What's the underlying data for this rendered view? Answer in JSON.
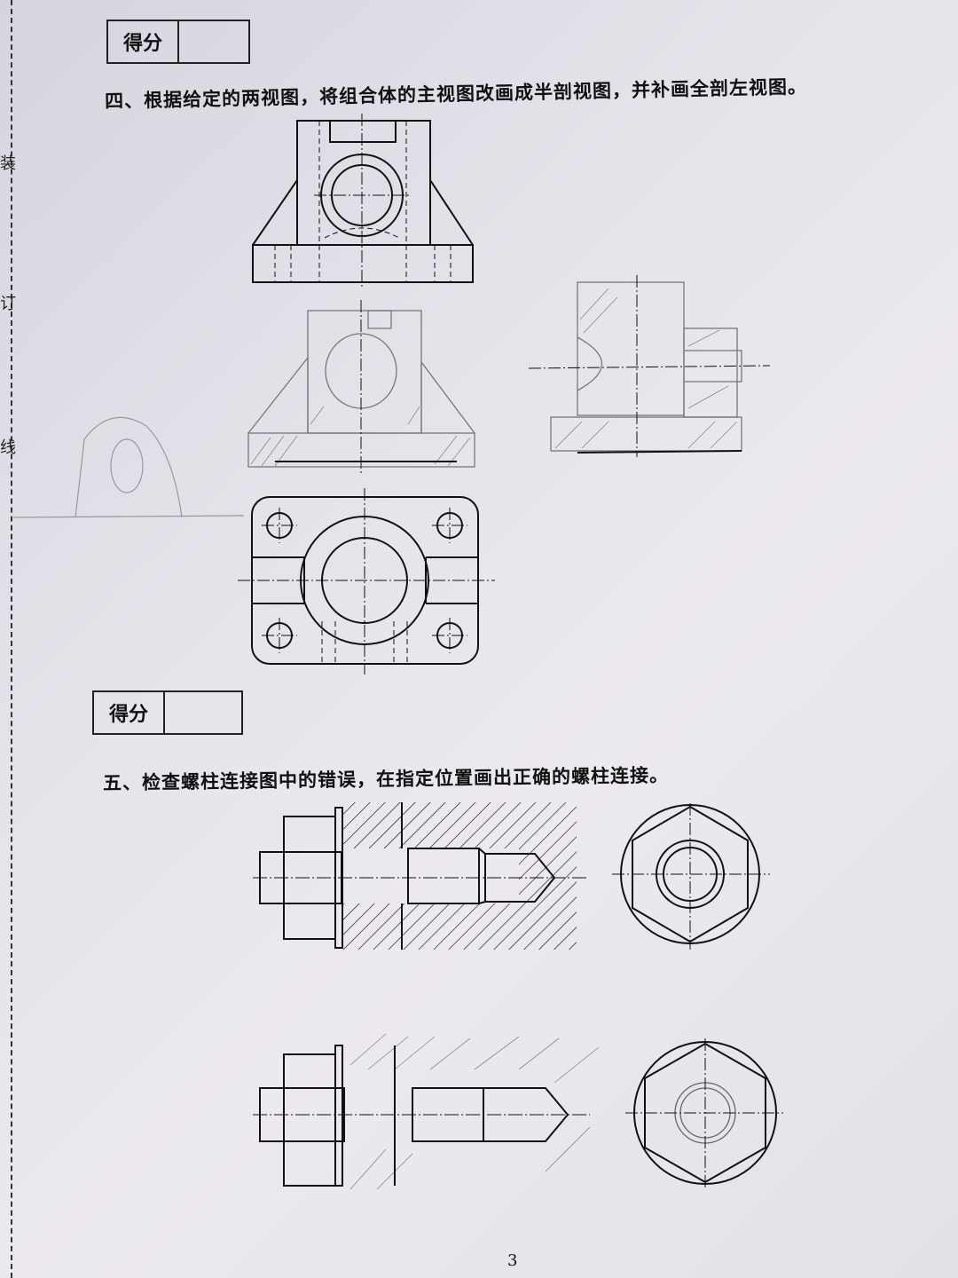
{
  "margin_marks": [
    "装",
    "订",
    "线"
  ],
  "section4": {
    "score_label": "得分",
    "question": "四、根据给定的两视图，将组合体的主视图改画成半剖视图，并补画全剖左视图。"
  },
  "section5": {
    "score_label": "得分",
    "question": "五、检查螺柱连接图中的错误，在指定位置画出正确的螺柱连接。"
  },
  "page_number": "3"
}
